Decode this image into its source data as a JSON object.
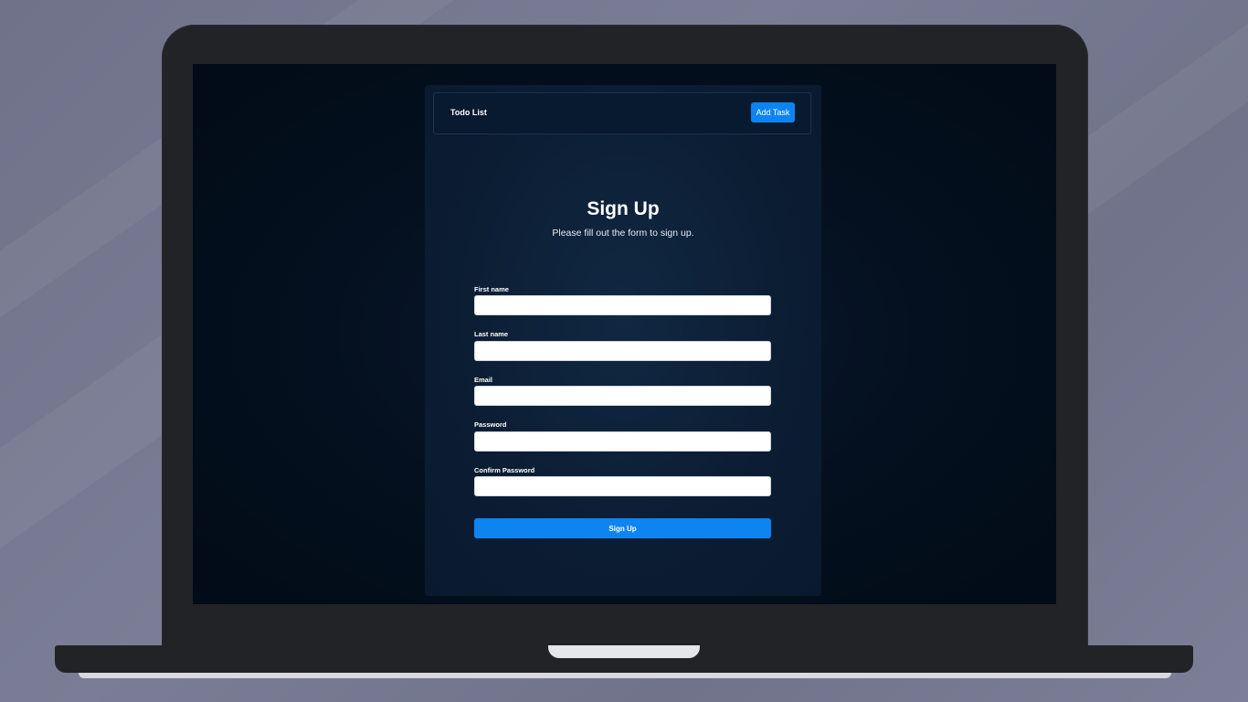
{
  "navbar": {
    "brand": "Todo List",
    "add_task_label": "Add Task"
  },
  "form": {
    "title": "Sign Up",
    "subtitle": "Please fill out the form to sign up.",
    "fields": [
      {
        "label": "First name",
        "value": "",
        "placeholder": ""
      },
      {
        "label": "Last name",
        "value": "",
        "placeholder": ""
      },
      {
        "label": "Email",
        "value": "",
        "placeholder": ""
      },
      {
        "label": "Password",
        "value": "",
        "placeholder": ""
      },
      {
        "label": "Confirm Password",
        "value": "",
        "placeholder": ""
      }
    ],
    "submit_label": "Sign Up"
  },
  "colors": {
    "accent": "#0d84f0",
    "panel_bg": "#0b1d33",
    "screen_bg": "#020b17",
    "laptop_body": "#222327",
    "wall": "#7a7d95"
  }
}
